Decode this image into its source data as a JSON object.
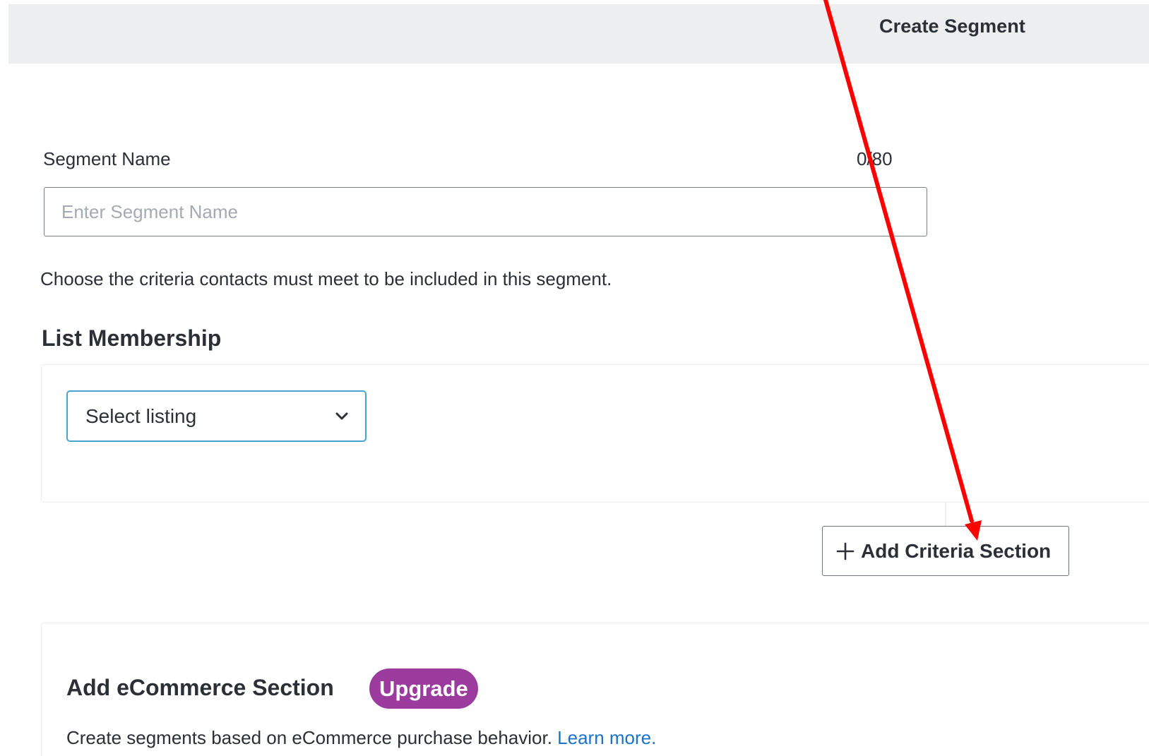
{
  "header": {
    "title": "Create Segment"
  },
  "segment_name": {
    "label": "Segment Name",
    "char_count": "0/80",
    "value": "",
    "placeholder": "Enter Segment Name"
  },
  "criteria_description": "Choose the criteria contacts must meet to be included in this segment.",
  "list_membership": {
    "heading": "List Membership",
    "select": {
      "selected_label": "Select listing",
      "icon": "chevron-down-icon"
    }
  },
  "add_criteria": {
    "label": "Add Criteria Section",
    "icon": "plus-icon"
  },
  "ecommerce": {
    "heading": "Add eCommerce Section",
    "badge": "Upgrade",
    "description": "Create segments based on eCommerce purchase behavior.",
    "link_text": "Learn more."
  },
  "colors": {
    "header_bg": "#eceef0",
    "select_border": "#4aa3cc",
    "badge_bg": "#9b3b9e",
    "link": "#1a73c8",
    "annotation_arrow": "#ff0000"
  }
}
